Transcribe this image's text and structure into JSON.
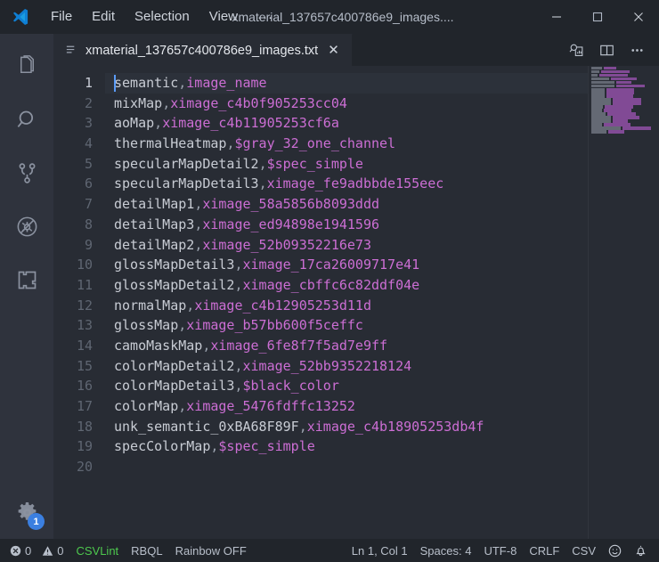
{
  "window": {
    "logo_icon": "vscode-logo-icon",
    "title": "xmaterial_137657c400786e9_images....",
    "menu": [
      "File",
      "Edit",
      "Selection",
      "View"
    ],
    "menu_overflow_label": "···",
    "controls": {
      "minimize_icon": "minimize-icon",
      "maximize_icon": "maximize-icon",
      "close_icon": "close-icon"
    }
  },
  "activitybar": {
    "items": [
      {
        "icon": "explorer-files-icon",
        "label": "Explorer"
      },
      {
        "icon": "search-icon",
        "label": "Search"
      },
      {
        "icon": "source-control-branch-icon",
        "label": "Source Control"
      },
      {
        "icon": "run-and-debug-disabled-icon",
        "label": "Run and Debug"
      },
      {
        "icon": "extensions-icon",
        "label": "Extensions"
      }
    ],
    "manage": {
      "icon": "gear-icon",
      "label": "Manage",
      "badge": "1"
    }
  },
  "tabs": {
    "active": {
      "icon": "text-file-icon",
      "label": "xmaterial_137657c400786e9_images.txt",
      "close_icon": "close-icon"
    },
    "actions": [
      {
        "icon": "csv-preview-icon",
        "label": "Preview CSV"
      },
      {
        "icon": "split-editor-icon",
        "label": "Split Editor Right"
      },
      {
        "icon": "more-actions-icon",
        "label": "More Actions..."
      }
    ]
  },
  "editor": {
    "active_line": 1,
    "separator": ",",
    "lines": [
      {
        "n": "1",
        "a": "semantic",
        "b": "image_name"
      },
      {
        "n": "2",
        "a": "mixMap",
        "b": "ximage_c4b0f905253cc04"
      },
      {
        "n": "3",
        "a": "aoMap",
        "b": "ximage_c4b11905253cf6a"
      },
      {
        "n": "4",
        "a": "thermalHeatmap",
        "b": "$gray_32_one_channel"
      },
      {
        "n": "5",
        "a": "specularMapDetail2",
        "b": "$spec_simple"
      },
      {
        "n": "6",
        "a": "specularMapDetail3",
        "b": "ximage_fe9adbbde155eec"
      },
      {
        "n": "7",
        "a": "detailMap1",
        "b": "ximage_58a5856b8093ddd"
      },
      {
        "n": "8",
        "a": "detailMap3",
        "b": "ximage_ed94898e1941596"
      },
      {
        "n": "9",
        "a": "detailMap2",
        "b": "ximage_52b09352216e73"
      },
      {
        "n": "10",
        "a": "glossMapDetail3",
        "b": "ximage_17ca26009717e41"
      },
      {
        "n": "11",
        "a": "glossMapDetail2",
        "b": "ximage_cbffc6c82ddf04e"
      },
      {
        "n": "12",
        "a": "normalMap",
        "b": "ximage_c4b12905253d11d"
      },
      {
        "n": "13",
        "a": "glossMap",
        "b": "ximage_b57bb600f5ceffc"
      },
      {
        "n": "14",
        "a": "camoMaskMap",
        "b": "ximage_6fe8f7f5ad7e9ff"
      },
      {
        "n": "15",
        "a": "colorMapDetail2",
        "b": "ximage_52bb9352218124"
      },
      {
        "n": "16",
        "a": "colorMapDetail3",
        "b": "$black_color"
      },
      {
        "n": "17",
        "a": "colorMap",
        "b": "ximage_5476fdffc13252"
      },
      {
        "n": "18",
        "a": "unk_semantic_0xBA68F89F",
        "b": "ximage_c4b18905253db4f"
      },
      {
        "n": "19",
        "a": "specColorMap",
        "b": "$spec_simple"
      },
      {
        "n": "20",
        "a": "",
        "b": ""
      }
    ]
  },
  "statusbar": {
    "errors_icon": "error-circle-icon",
    "errors": "0",
    "warnings_icon": "warning-triangle-icon",
    "warnings": "0",
    "csvlint": "CSVLint",
    "rbql": "RBQL",
    "rainbow": "Rainbow OFF",
    "cursor": "Ln 1, Col 1",
    "indent": "Spaces: 4",
    "encoding": "UTF-8",
    "eol": "CRLF",
    "language": "CSV",
    "feedback_icon": "smiley-icon",
    "notifications_icon": "bell-icon"
  },
  "colors": {
    "titlebar_bg": "#21252b",
    "activitybar_bg": "#2f333d",
    "editor_bg": "#282c34",
    "column1": "#c8ccd4",
    "column2": "#cc6ed4",
    "accent": "#3b7fe0",
    "csvlint_green": "#4ec94e",
    "cursor": "#5a9bf6"
  }
}
